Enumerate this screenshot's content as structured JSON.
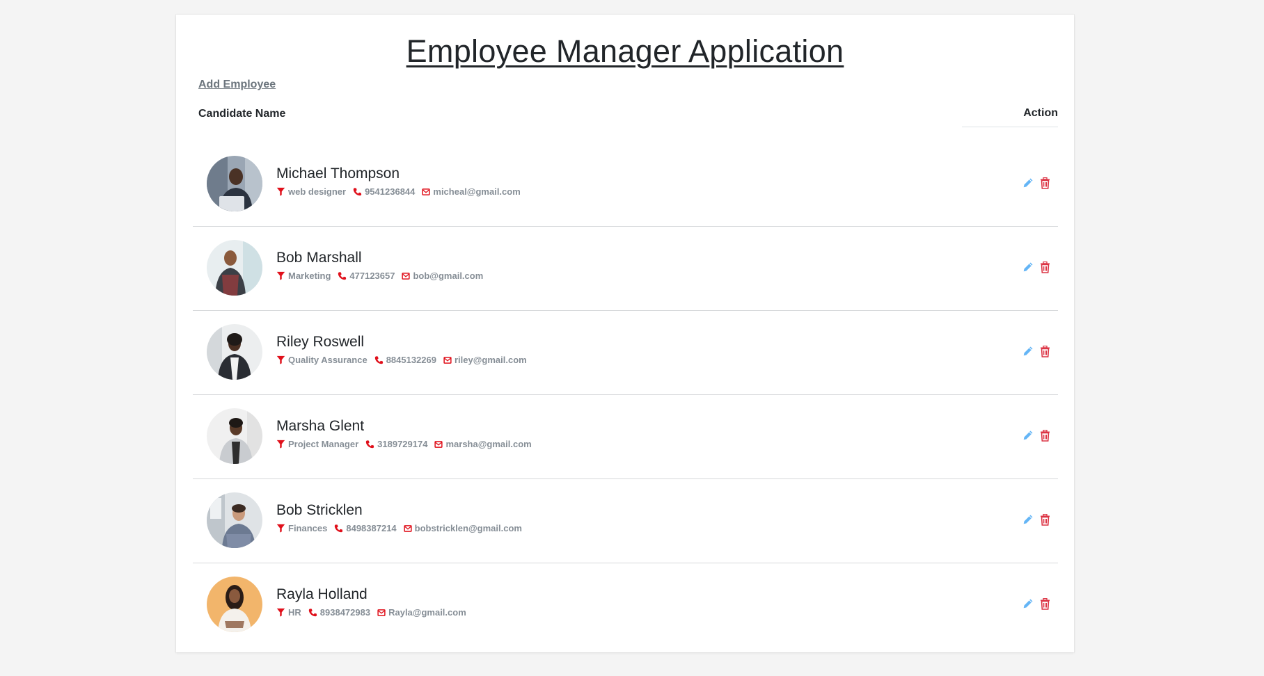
{
  "app": {
    "title": "Employee Manager Application",
    "add_employee_label": "Add Employee"
  },
  "table": {
    "headers": {
      "name": "Candidate Name",
      "action": "Action"
    }
  },
  "colors": {
    "icon_red": "#e0101b",
    "edit_blue": "#64b5f6",
    "delete_red": "#dc3545"
  },
  "employees": [
    {
      "name": "Michael Thompson",
      "role": "web designer",
      "phone": "9541236844",
      "email": "micheal@gmail.com"
    },
    {
      "name": "Bob Marshall",
      "role": "Marketing",
      "phone": "477123657",
      "email": "bob@gmail.com"
    },
    {
      "name": "Riley Roswell",
      "role": "Quality Assurance",
      "phone": "8845132269",
      "email": "riley@gmail.com"
    },
    {
      "name": "Marsha Glent",
      "role": "Project Manager",
      "phone": "3189729174",
      "email": "marsha@gmail.com"
    },
    {
      "name": "Bob Stricklen",
      "role": "Finances",
      "phone": "8498387214",
      "email": "bobstricklen@gmail.com"
    },
    {
      "name": "Rayla Holland",
      "role": "HR",
      "phone": "8938472983",
      "email": "Rayla@gmail.com"
    }
  ]
}
